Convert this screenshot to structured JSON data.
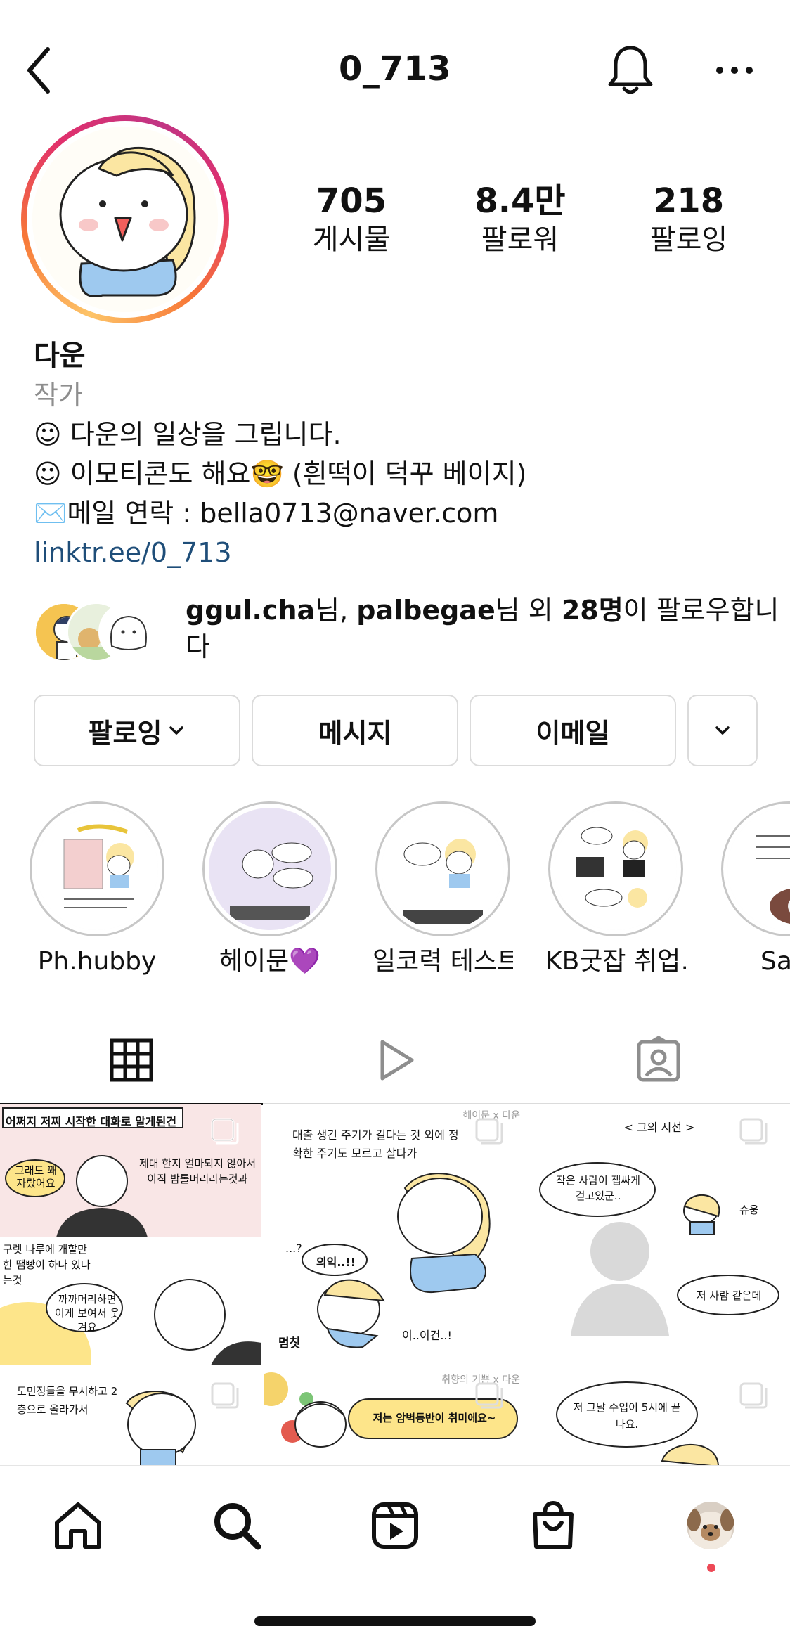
{
  "header": {
    "username": "0_713"
  },
  "stats": [
    {
      "value": "705",
      "label": "게시물"
    },
    {
      "value": "8.4만",
      "label": "팔로워"
    },
    {
      "value": "218",
      "label": "팔로잉"
    }
  ],
  "bio": {
    "name": "다운",
    "category": "작가",
    "lines": [
      "☺︎ 다운의 일상을 그립니다.",
      "☺︎ 이모티콘도 해요🤓 (흰떡이 덕꾸 베이지)",
      "✉️메일 연락 : bella0713@naver.com"
    ],
    "link": "linktr.ee/0_713"
  },
  "followed_by": {
    "user1": "ggul.cha",
    "suffix1": "님, ",
    "user2": "palbegae",
    "suffix2": "님 외 ",
    "count": "28명",
    "suffix3": "이 팔로우합니다"
  },
  "actions": {
    "following_label": "팔로잉",
    "message_label": "메시지",
    "email_label": "이메일"
  },
  "highlights": [
    {
      "label": "Ph.hubby"
    },
    {
      "label": "헤이문💜"
    },
    {
      "label": "일코력 테스트"
    },
    {
      "label": "KB굿잡 취업…"
    },
    {
      "label": "Sam"
    }
  ],
  "posts": [
    {
      "text_top": "어쩌지 저찌 시작한 대화로 알게된건",
      "bubble": "그래도 꽤 자랐어요",
      "side": "제대 한지 얼마되지 않아서 아직 밤톨머리라는것과",
      "bottom": "구렛 나루에 개할만한 땜빵이 하나 있다는것",
      "bubble2": "까까머리하면 이게 보여서 웃겨요"
    },
    {
      "text_top": "대출 생긴 주기가 길다는 것 외에 정확한 주기도 모르고 살다가",
      "credit": "헤이문 x 다운",
      "bubble": "의익..!!",
      "q": "...?",
      "sfx": "멈칫",
      "sfx2": "이..이건..!"
    },
    {
      "text_top": "< 그의 시선 >",
      "bubble": "작은 사람이 잽싸게 걷고있군..",
      "sfx": "슈웅",
      "bubble2": "저 사람 같은데"
    },
    {
      "text_top": "도민정들을 무시하고 2층으로 올라가서"
    },
    {
      "credit": "취향의 기쁨 x 다운",
      "bubble": "저는 암벽등반이 취미에요~"
    },
    {
      "bubble": "저 그날 수업이 5시에 끝나요."
    }
  ],
  "colors": {
    "link": "#1f4e79",
    "muted": "#8e8e8e",
    "border": "#dbdbdb",
    "notification": "#ed4956",
    "hair": "#fbe6a2",
    "shirt": "#9ec9ef"
  }
}
